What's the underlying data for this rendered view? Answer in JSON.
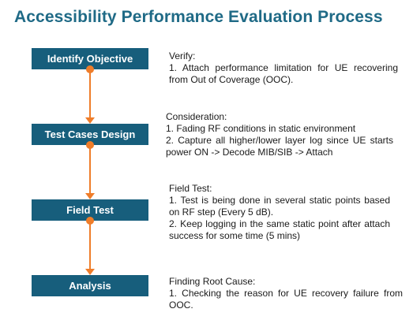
{
  "title": "Accessibility Performance Evaluation Process",
  "steps": [
    {
      "label": "Identify Objective",
      "heading": "Verify:",
      "lines": [
        "1.  Attach  performance  limitation  for  UE recovering from Out of Coverage (OOC)."
      ]
    },
    {
      "label": "Test Cases Design",
      "heading": "Consideration:",
      "lines": [
        "1. Fading RF conditions in static environment",
        "2.  Capture  all  higher/lower  layer  log  since  UE starts power ON -> Decode MIB/SIB -> Attach"
      ]
    },
    {
      "label": "Field Test",
      "heading": "Field Test:",
      "lines": [
        "1. Test is being done in several static points based on RF step (Every 5 dB).",
        "2.  Keep  logging  in  the  same  static  point  after attach success for some time (5 mins)"
      ]
    },
    {
      "label": "Analysis",
      "heading": "Finding Root Cause:",
      "lines": [
        "1.  Checking  the  reason  for  UE recovery  failure  from OOC."
      ]
    }
  ],
  "colors": {
    "title": "#1f6a86",
    "step_box": "#175e7c",
    "connector": "#ef7d2a"
  }
}
